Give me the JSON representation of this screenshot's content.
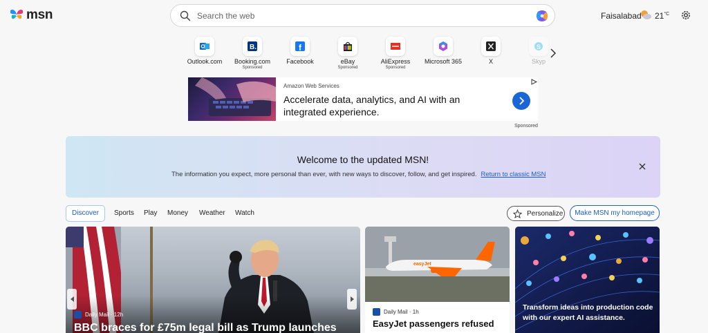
{
  "header": {
    "logo_text": "msn",
    "search_placeholder": "Search the web",
    "location": "Faisalabad",
    "temperature": "21",
    "temp_unit": "°C"
  },
  "quick_links": [
    {
      "label": "Outlook.com",
      "sub": ""
    },
    {
      "label": "Booking.com",
      "sub": "Sponsored"
    },
    {
      "label": "Facebook",
      "sub": ""
    },
    {
      "label": "eBay",
      "sub": "Sponsored"
    },
    {
      "label": "AliExpress",
      "sub": "Sponsored"
    },
    {
      "label": "Microsoft 365",
      "sub": ""
    },
    {
      "label": "X",
      "sub": ""
    },
    {
      "label": "Skyp",
      "sub": ""
    }
  ],
  "ad": {
    "source": "Amazon Web Services",
    "title": "Accelerate data, analytics, and AI with an integrated experience.",
    "sponsored": "Sponsored"
  },
  "banner": {
    "title": "Welcome to the updated MSN!",
    "text": "The information you expect, more personal than ever, with new ways to discover, follow, and get inspired.",
    "link": "Return to classic MSN"
  },
  "tabs": [
    "Discover",
    "Sports",
    "Play",
    "Money",
    "Weather",
    "Watch"
  ],
  "buttons": {
    "personalize": "Personalize",
    "homepage": "Make MSN my homepage"
  },
  "cards": {
    "main": {
      "source": "Daily Mail · 12h",
      "headline": "BBC braces for £75m legal bill as Trump launches"
    },
    "mid": {
      "source": "Daily Mail · 1h",
      "headline": "EasyJet passengers refused"
    },
    "right": {
      "text": "Transform ideas into production code with our expert AI assistance."
    }
  }
}
